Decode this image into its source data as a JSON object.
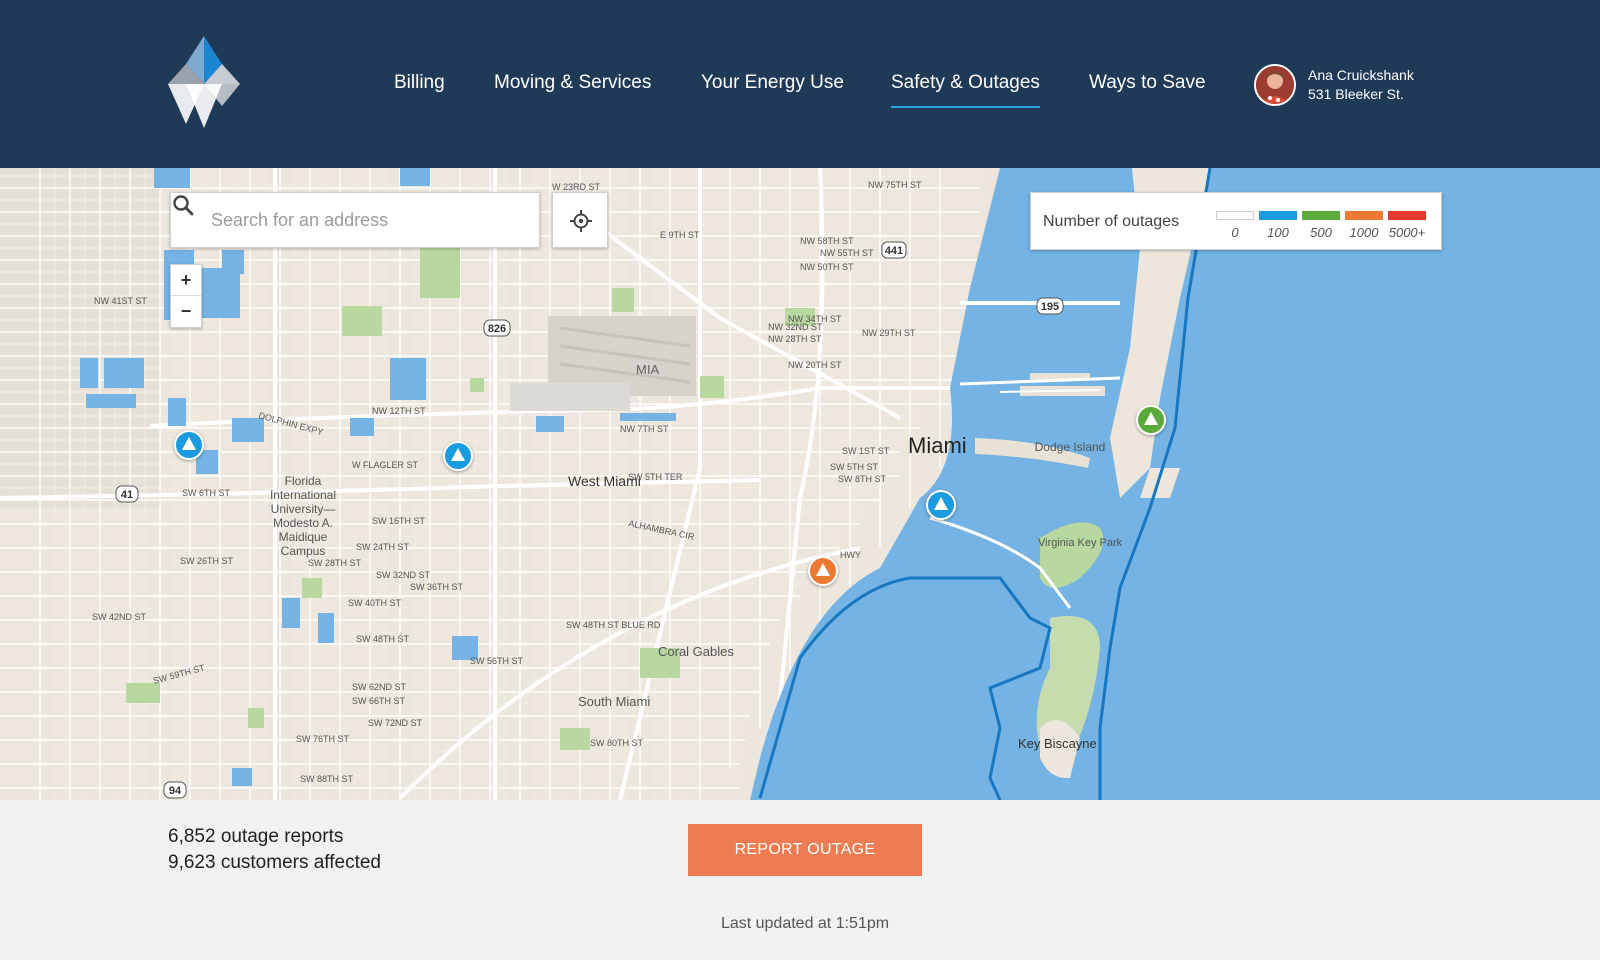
{
  "nav": {
    "items": [
      {
        "label": "Billing",
        "active": false
      },
      {
        "label": "Moving & Services",
        "active": false
      },
      {
        "label": "Your Energy Use",
        "active": false
      },
      {
        "label": "Safety & Outages",
        "active": true
      },
      {
        "label": "Ways to Save",
        "active": false
      }
    ]
  },
  "user": {
    "name": "Ana Cruickshank",
    "address": "531 Bleeker St."
  },
  "search": {
    "placeholder": "Search for an address"
  },
  "zoom": {
    "in_label": "+",
    "out_label": "−"
  },
  "legend": {
    "title": "Number of outages",
    "items": [
      {
        "label": "0",
        "color": "#ffffff"
      },
      {
        "label": "100",
        "color": "#1a9be0"
      },
      {
        "label": "500",
        "color": "#5aab3c"
      },
      {
        "label": "1000",
        "color": "#ec7a32"
      },
      {
        "label": "5000+",
        "color": "#e23a2e"
      }
    ]
  },
  "map": {
    "labels": {
      "city": "Miami",
      "west_miami": "West Miami",
      "coral_gables": "Coral Gables",
      "south_miami": "South Miami",
      "dodge_island": "Dodge Island",
      "virginia_key": "Virginia Key Park",
      "key_biscayne": "Key Biscayne",
      "mia": "MIA",
      "fiu": "Florida International University— Modesto A. Maidique Campus"
    },
    "streets": [
      "W 23RD ST",
      "NW 75TH ST",
      "E 9TH ST",
      "NW 58TH ST",
      "NW 55TH ST",
      "NW 50TH ST",
      "NW 41ST ST",
      "NW 34TH ST",
      "NW 32ND ST",
      "NW 28TH ST",
      "NW 29TH ST",
      "NW 20TH ST",
      "NW 12TH ST",
      "DOLPHIN EXPY",
      "NW 7TH ST",
      "W FLAGLER ST",
      "SW 5TH TER",
      "SW 1ST ST",
      "SW 5TH ST",
      "SW 8TH ST",
      "SW 6TH ST",
      "SW 16TH ST",
      "SW 24TH ST",
      "ALHAMBRA CIR",
      "SW 26TH ST",
      "SW 28TH ST",
      "SW 32ND ST",
      "SW 36TH ST",
      "SW 40TH ST",
      "SW 42ND ST",
      "SW 48TH ST",
      "SW 48TH ST BLUE RD",
      "SW 56TH ST",
      "SW 59TH ST",
      "SW 62ND ST",
      "SW 66TH ST",
      "SW 72ND ST",
      "SW 76TH ST",
      "SW 80TH ST",
      "SW 88TH ST",
      "HWY"
    ],
    "shields": [
      "826",
      "441",
      "195",
      "41",
      "94"
    ],
    "markers": [
      {
        "level": "100",
        "color": "#1a9be0"
      },
      {
        "level": "100",
        "color": "#1a9be0"
      },
      {
        "level": "100",
        "color": "#1a9be0"
      },
      {
        "level": "1000",
        "color": "#ec7a32"
      },
      {
        "level": "500",
        "color": "#5aab3c"
      }
    ]
  },
  "stats": {
    "reports": "6,852 outage reports",
    "customers": "9,623 customers affected"
  },
  "actions": {
    "report_label": "REPORT OUTAGE"
  },
  "updated": "Last updated at 1:51pm",
  "colors": {
    "header_bg": "#1f3a57",
    "nav_active_underline": "#2aa4e6",
    "report_button": "#ee7b52",
    "water": "#74b3e3",
    "land": "#ece6dc"
  }
}
